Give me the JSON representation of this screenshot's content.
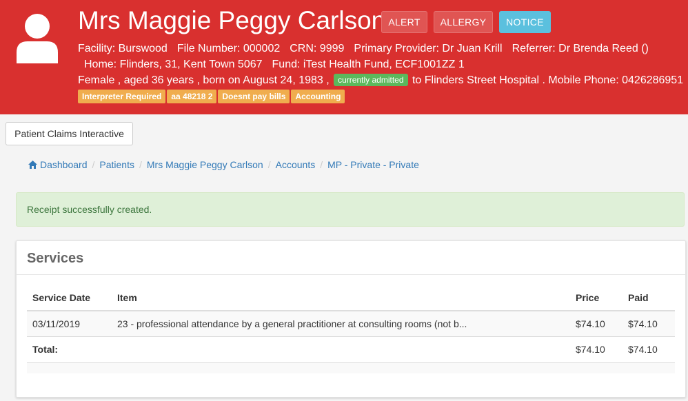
{
  "patient": {
    "name": "Mrs Maggie Peggy Carlson",
    "buttons": {
      "alert": "ALERT",
      "allergy": "ALLERGY",
      "notice": "NOTICE"
    },
    "line1": {
      "facility": "Facility: Burswood",
      "file_number": "File Number: 000002",
      "crn": "CRN: 9999",
      "primary_provider": "Primary Provider: Dr Juan Krill",
      "referrer": "Referrer: Dr Brenda Reed ()"
    },
    "line2": {
      "home": "Home: Flinders, 31, Kent Town 5067",
      "fund": "Fund: iTest Health Fund, ECF1001ZZ 1"
    },
    "line3": {
      "demographics": "Female , aged 36 years , born on August 24, 1983 ,",
      "admission_badge": "currently admitted",
      "admission_location": "to Flinders Street Hospital . Mobile Phone: 0426286951"
    },
    "flags": [
      "Interpreter Required",
      "aa 48218 2",
      "Doesnt pay bills",
      "Accounting"
    ]
  },
  "toolbar": {
    "claims_button": "Patient Claims Interactive"
  },
  "breadcrumb": [
    "Dashboard",
    "Patients",
    "Mrs Maggie Peggy Carlson",
    "Accounts",
    "MP - Private - Private"
  ],
  "alert": {
    "message": "Receipt successfully created."
  },
  "services": {
    "title": "Services",
    "columns": {
      "date": "Service Date",
      "item": "Item",
      "price": "Price",
      "paid": "Paid"
    },
    "rows": [
      {
        "date": "03/11/2019",
        "item": "23 - professional attendance by a general practitioner at consulting rooms (not b...",
        "price": "$74.10",
        "paid": "$74.10"
      }
    ],
    "total": {
      "label": "Total:",
      "price": "$74.10",
      "paid": "$74.10"
    }
  },
  "colors": {
    "header_red": "#d9302f",
    "notice_blue": "#5bc0de",
    "flag_orange": "#f0ad4e",
    "admitted_green": "#5cb85c",
    "link_blue": "#337ab7",
    "success_bg": "#dff0d8"
  },
  "icons": {
    "avatar": "user-icon",
    "breadcrumb_home": "home-icon"
  }
}
